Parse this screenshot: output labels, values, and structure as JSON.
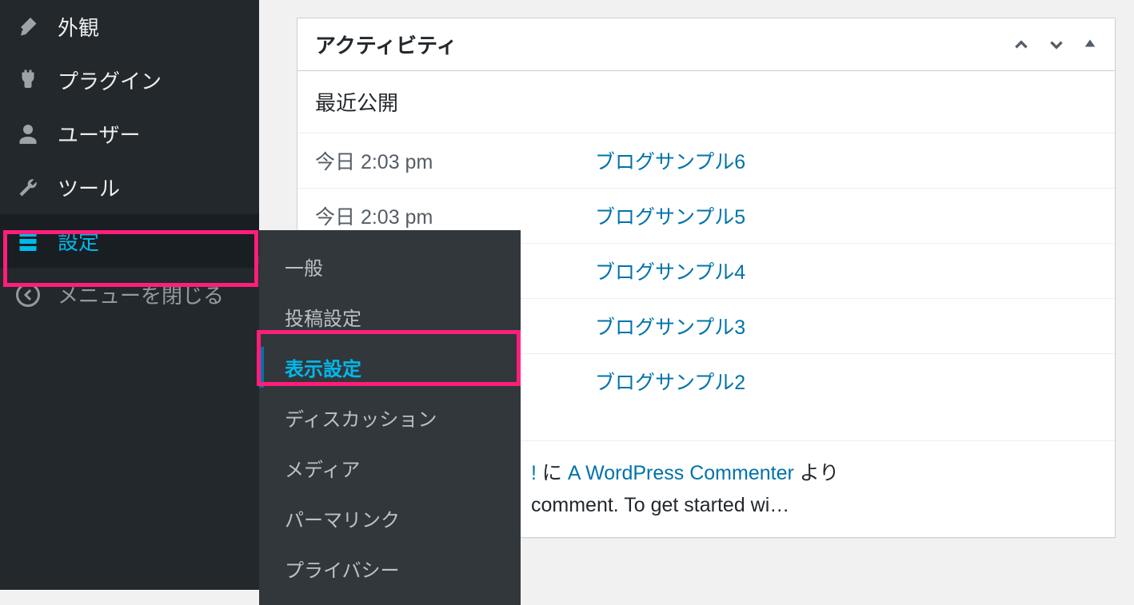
{
  "sidebar": {
    "items": [
      {
        "label": "外観"
      },
      {
        "label": "プラグイン"
      },
      {
        "label": "ユーザー"
      },
      {
        "label": "ツール"
      },
      {
        "label": "設定"
      },
      {
        "label": "メニューを閉じる"
      }
    ]
  },
  "submenu": {
    "items": [
      {
        "label": "一般"
      },
      {
        "label": "投稿設定"
      },
      {
        "label": "表示設定"
      },
      {
        "label": "ディスカッション"
      },
      {
        "label": "メディア"
      },
      {
        "label": "パーマリンク"
      },
      {
        "label": "プライバシー"
      }
    ]
  },
  "activity": {
    "title": "アクティビティ",
    "recent_title": "最近公開",
    "posts": [
      {
        "date": "今日 2:03 pm",
        "title": "ブログサンプル6"
      },
      {
        "date": "今日 2:03 pm",
        "title": "ブログサンプル5"
      },
      {
        "date": "",
        "title": "ブログサンプル4"
      },
      {
        "date": "",
        "title": "ブログサンプル3"
      },
      {
        "date": "",
        "title": "ブログサンプル2"
      }
    ],
    "comment": {
      "prefix": "!",
      "mid": " に ",
      "commenter": "A WordPress Commenter",
      "suffix": " より",
      "body": "comment. To get started wi…"
    }
  }
}
